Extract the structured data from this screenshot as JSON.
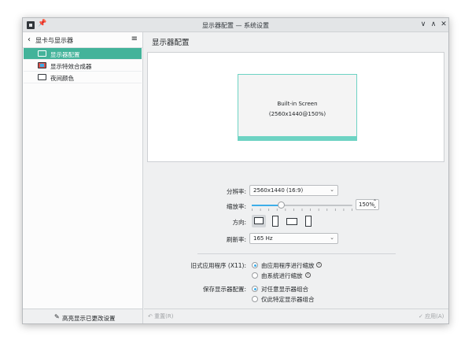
{
  "window": {
    "title": "显示器配置 — 系统设置"
  },
  "titlebar_buttons": {
    "minimize": "∨",
    "maximize": "∧",
    "close": "✕"
  },
  "sidebar": {
    "title": "显卡与显示器",
    "items": [
      {
        "label": "显示器配置",
        "icon": "monitor-icon"
      },
      {
        "label": "显示特效合成器",
        "icon": "effects-icon"
      },
      {
        "label": "夜间颜色",
        "icon": "monitor-icon"
      }
    ],
    "footer": "高亮显示已更改设置"
  },
  "main": {
    "title": "显示器配置",
    "screen": {
      "name": "Built-in Screen",
      "detail": "(2560x1440@150%)"
    },
    "resolution": {
      "label": "分辨率:",
      "value": "2560x1440 (16:9)"
    },
    "scale": {
      "label": "缩放率:",
      "value": "150%",
      "level": 0.29
    },
    "orientation": {
      "label": "方向:"
    },
    "refresh": {
      "label": "刷新率:",
      "value": "165 Hz"
    },
    "legacy": {
      "label": "旧式应用程序 (X11):",
      "options": [
        "由应用程序进行缩放",
        "由系统进行缩放"
      ],
      "selected": 0
    },
    "save": {
      "label": "保存显示器配置:",
      "options": [
        "对任意显示器组合",
        "仅此特定显示器组合"
      ],
      "selected": 0
    }
  },
  "bottom": {
    "reset": "重置(R)",
    "apply": "应用(A)"
  },
  "colors": {
    "accent": "#43b39a",
    "screen_outline": "#6dd3c3",
    "slider": "#3daee9"
  }
}
